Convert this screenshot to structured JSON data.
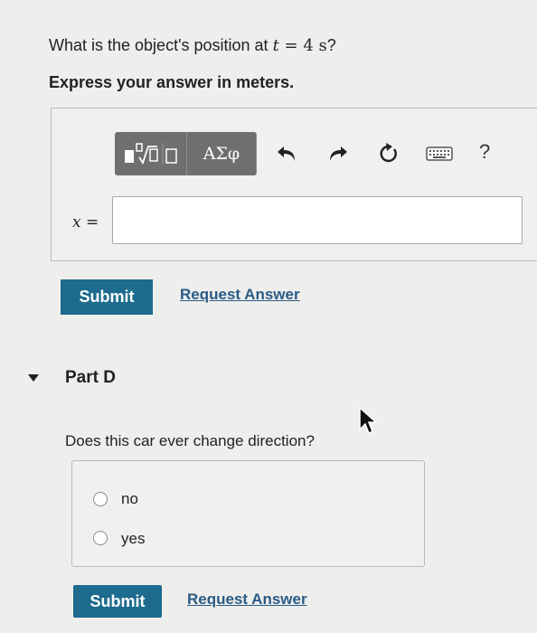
{
  "question": {
    "prefix": "What is the object's position at ",
    "var": "t",
    "equals": " = ",
    "value": "4",
    "unit": " s",
    "suffix": "?"
  },
  "instruction": "Express your answer in meters.",
  "toolbar": {
    "greek_label": "ΑΣφ",
    "help_label": "?"
  },
  "answer": {
    "label_var": "x",
    "label_eq": " =",
    "value": ""
  },
  "part_c_actions": {
    "submit_label": "Submit",
    "request_label": "Request Answer"
  },
  "part_d": {
    "title": "Part D",
    "question": "Does this car ever change direction?",
    "choices": [
      {
        "label": "no",
        "selected": false
      },
      {
        "label": "yes",
        "selected": false
      }
    ],
    "submit_label": "Submit",
    "request_label": "Request Answer"
  },
  "colors": {
    "submit": "#1d6b8e",
    "link": "#2a5b86",
    "toolbar": "#6f6f6f"
  }
}
